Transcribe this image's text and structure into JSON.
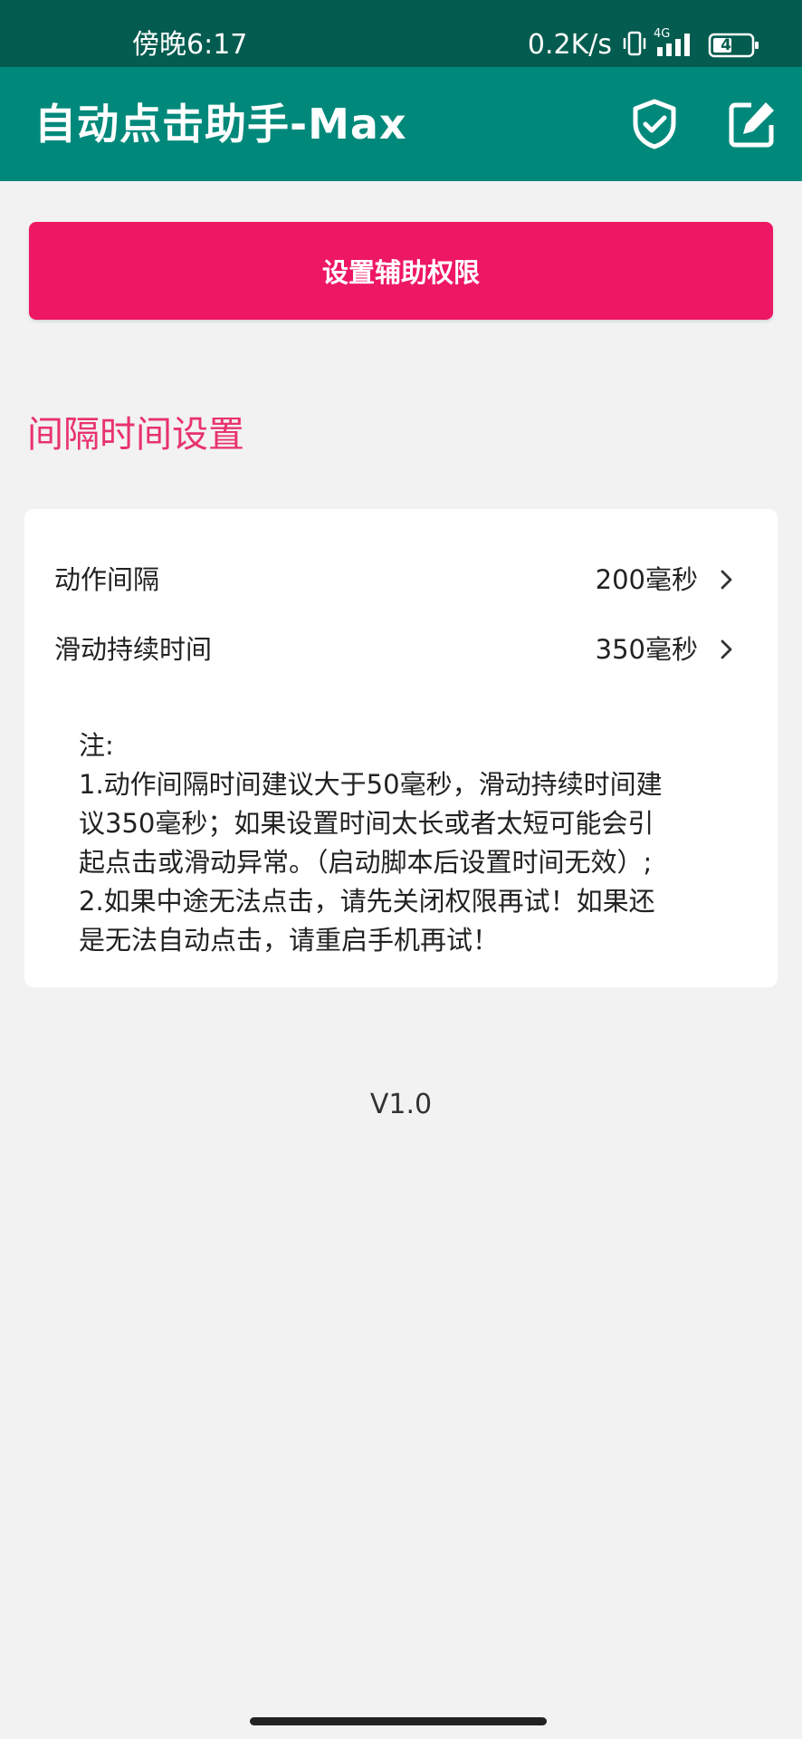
{
  "status_bar": {
    "time": "傍晚6:17",
    "speed": "0.2K/s",
    "network_label": "4G",
    "battery": "48",
    "icons": [
      "vibrate-icon",
      "signal-icon",
      "battery-icon"
    ]
  },
  "app_bar": {
    "title": "自动点击助手-Max",
    "actions": [
      "shield-check-icon",
      "edit-icon"
    ]
  },
  "permission_button": {
    "label": "设置辅助权限",
    "color": "#ee1763"
  },
  "interval_section": {
    "title": "间隔时间设置",
    "rows": [
      {
        "label": "动作间隔",
        "value": "200毫秒"
      },
      {
        "label": "滑动持续时间",
        "value": "350毫秒"
      }
    ],
    "note_lines": [
      "注:",
      "1.动作间隔时间建议大于50毫秒，滑动持续时间建",
      "议350毫秒；如果设置时间太长或者太短可能会引",
      "起点击或滑动异常。（启动脚本后设置时间无效）;",
      "2.如果中途无法点击，请先关闭权限再试！如果还",
      "是无法自动点击，请重启手机再试！"
    ]
  },
  "version": "V1.0",
  "colors": {
    "status_bar": "#035c4f",
    "app_bar": "#00897b",
    "accent": "#e8336d",
    "background": "#f2f2f2"
  }
}
